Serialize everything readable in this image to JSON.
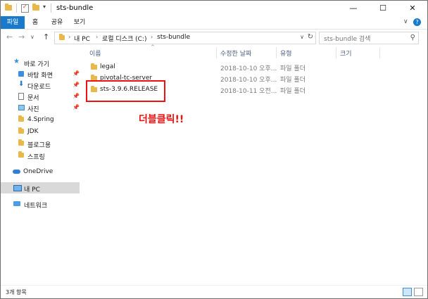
{
  "window": {
    "title": "sts-bundle",
    "controls": {
      "minimize": "—",
      "maximize": "☐",
      "close": "✕"
    }
  },
  "ribbon": {
    "tabs": [
      "파일",
      "홈",
      "공유",
      "보기"
    ],
    "collapse": "∨",
    "help": "?"
  },
  "nav": {
    "back": "←",
    "forward": "→",
    "recent": "∨",
    "up": "↑",
    "breadcrumbs": [
      "내 PC",
      "로컬 디스크 (C:)",
      "sts-bundle"
    ],
    "search_placeholder": "sts-bundle 검색"
  },
  "sidebar": {
    "items": [
      {
        "label": "바로 가기",
        "icon": "star-icon"
      },
      {
        "label": "바탕 화면",
        "icon": "desktop-icon",
        "pinned": true
      },
      {
        "label": "다운로드",
        "icon": "download-icon",
        "pinned": true
      },
      {
        "label": "문서",
        "icon": "document-icon",
        "pinned": true
      },
      {
        "label": "사진",
        "icon": "picture-icon",
        "pinned": true
      },
      {
        "label": "4.Spring",
        "icon": "folder-icon"
      },
      {
        "label": "JDK",
        "icon": "folder-icon"
      },
      {
        "label": "블로그용",
        "icon": "folder-icon"
      },
      {
        "label": "스프링",
        "icon": "folder-icon"
      },
      {
        "label": "OneDrive",
        "icon": "cloud-icon"
      },
      {
        "label": "내 PC",
        "icon": "computer-icon",
        "selected": true
      },
      {
        "label": "네트워크",
        "icon": "network-icon"
      }
    ]
  },
  "columns": {
    "name": "이름",
    "modified": "수정한 날짜",
    "type": "유형",
    "size": "크기"
  },
  "files": [
    {
      "name": "legal",
      "modified": "2018-10-10 오후...",
      "type": "파일 폴더"
    },
    {
      "name": "pivotal-tc-server",
      "modified": "2018-10-10 오후...",
      "type": "파일 폴더"
    },
    {
      "name": "sts-3.9.6.RELEASE",
      "modified": "2018-10-11 오전...",
      "type": "파일 폴더"
    }
  ],
  "annotation": "더블클릭!!",
  "status": {
    "item_count": "3개 항목"
  },
  "colors": {
    "accent": "#1979ca",
    "annotation": "#ee1111",
    "folder": "#e8b84a"
  }
}
